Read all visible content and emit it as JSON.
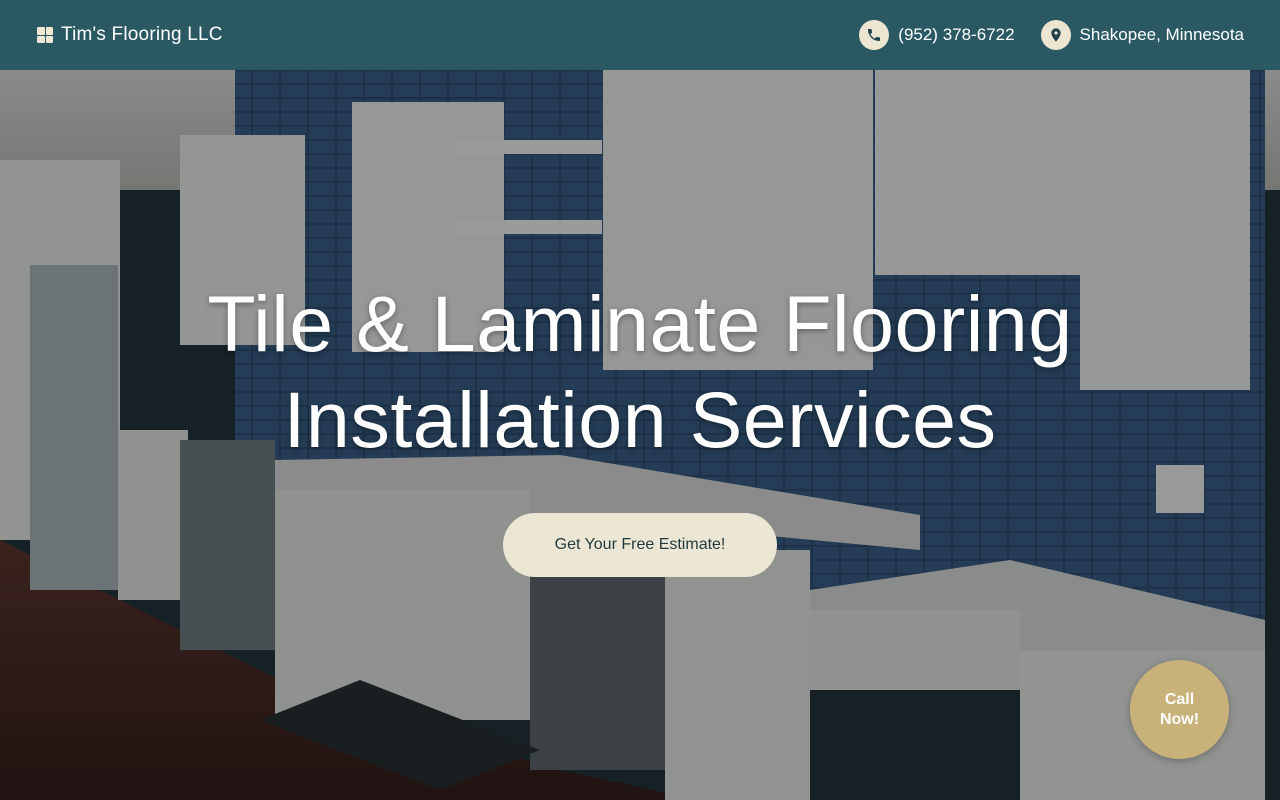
{
  "header": {
    "brand_name": "Tim's Flooring LLC",
    "brand_icon": "grid-logo-icon",
    "phone": "(952) 378-6722",
    "phone_icon": "phone-icon",
    "location": "Shakopee, Minnesota",
    "location_icon": "location-pin-icon"
  },
  "hero": {
    "title_line1": "Tile & Laminate Flooring",
    "title_line2": "Installation Services",
    "cta_label": "Get Your Free Estimate!"
  },
  "floating": {
    "call_label": "Call Now!"
  },
  "colors": {
    "header_bg": "#2a5863",
    "accent_cream": "#ece7d4",
    "call_button": "#c9b27a"
  }
}
